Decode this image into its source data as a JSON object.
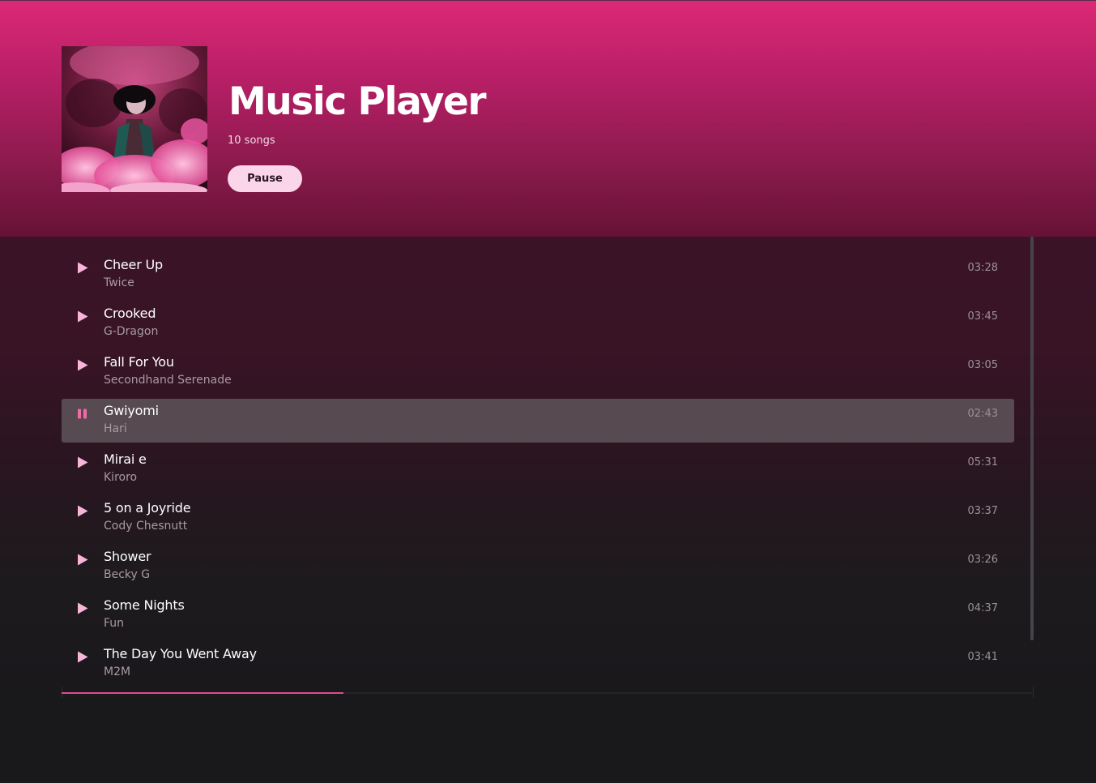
{
  "header": {
    "title": "Music Player",
    "song_count": "10 songs",
    "pause_label": "Pause"
  },
  "songs": [
    {
      "title": "Cheer Up",
      "artist": "Twice",
      "duration": "03:28",
      "state": "play"
    },
    {
      "title": "Crooked",
      "artist": "G-Dragon",
      "duration": "03:45",
      "state": "play"
    },
    {
      "title": "Fall For You",
      "artist": "Secondhand Serenade",
      "duration": "03:05",
      "state": "play"
    },
    {
      "title": "Gwiyomi",
      "artist": "Hari",
      "duration": "02:43",
      "state": "pause",
      "active": true
    },
    {
      "title": "Mirai e",
      "artist": "Kiroro",
      "duration": "05:31",
      "state": "play"
    },
    {
      "title": "5 on a Joyride",
      "artist": "Cody Chesnutt",
      "duration": "03:37",
      "state": "play"
    },
    {
      "title": "Shower",
      "artist": "Becky G",
      "duration": "03:26",
      "state": "play"
    },
    {
      "title": "Some Nights",
      "artist": "Fun",
      "duration": "04:37",
      "state": "play"
    },
    {
      "title": "The Day You Went Away",
      "artist": "M2M",
      "duration": "03:41",
      "state": "play"
    }
  ],
  "icons": {
    "play": "play-icon",
    "pause": "pause-icon"
  },
  "playback": {
    "progress": 0.29
  },
  "colors": {
    "accent": "#e04a91",
    "play_icon": "#f7b6d9",
    "pause_icon": "#f06aa8",
    "active_row": "#574a51",
    "button_bg": "#fbd6ea"
  }
}
